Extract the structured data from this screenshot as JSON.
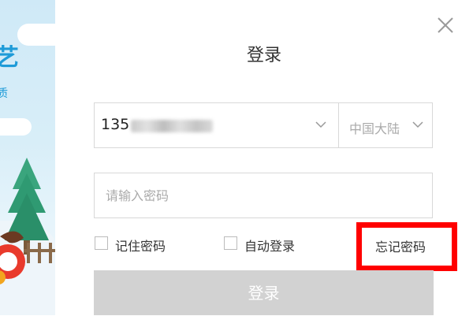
{
  "left_panel": {
    "brand_char": "艺",
    "brand_sub": "质"
  },
  "dialog": {
    "title": "登录",
    "close_icon": "close-icon",
    "phone": {
      "prefix": "135",
      "region": "中国大陆"
    },
    "password": {
      "placeholder": "请输入密码",
      "value": ""
    },
    "remember_password_label": "记住密码",
    "auto_login_label": "自动登录",
    "forgot_password_label": "忘记密码",
    "login_button_label": "登录"
  },
  "colors": {
    "accent_blue": "#1e9bd8",
    "highlight_red": "#ff0000",
    "button_disabled": "#d2d2d2"
  }
}
